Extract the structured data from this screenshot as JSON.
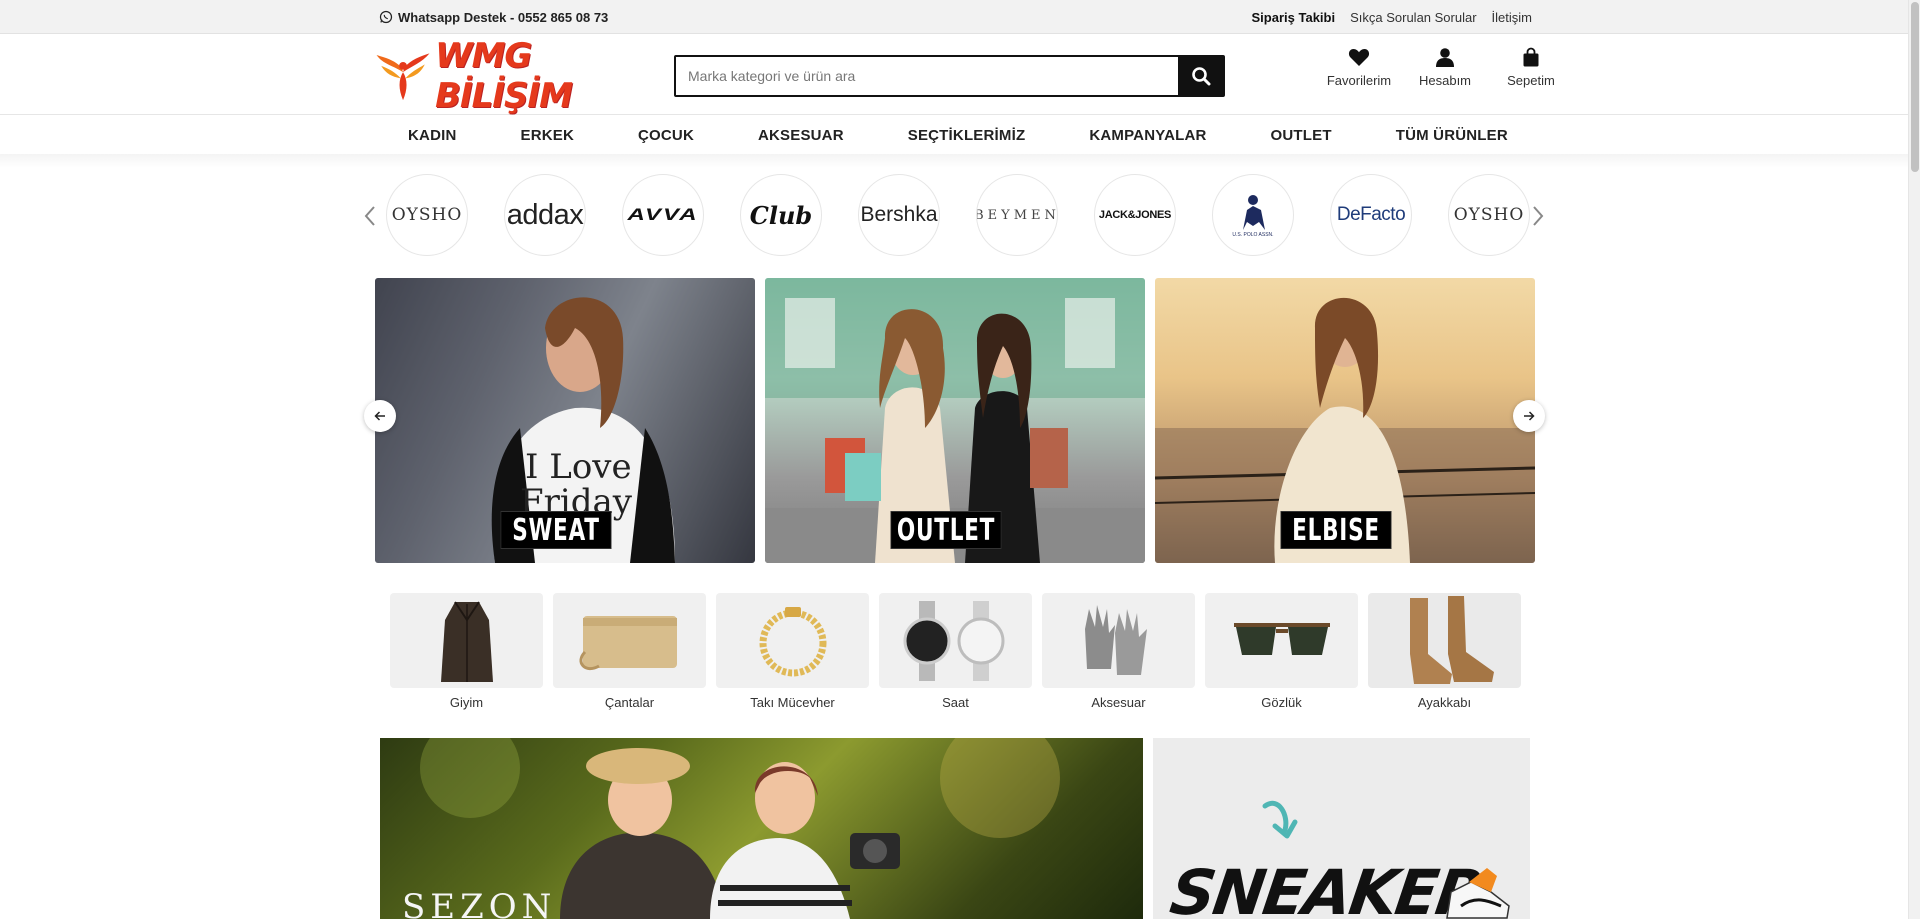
{
  "topbar": {
    "whatsapp": "Whatsapp Destek - 0552 865 08 73",
    "links": [
      "Sipariş Takibi",
      "Sıkça Sorulan Sorular",
      "İletişim"
    ]
  },
  "header": {
    "logo_text": "WMG BİLİŞİM",
    "search_placeholder": "Marka kategori ve ürün ara",
    "icons": [
      {
        "label": "Favorilerim",
        "icon": "heart-icon"
      },
      {
        "label": "Hesabım",
        "icon": "user-icon"
      },
      {
        "label": "Sepetim",
        "icon": "shopping-bag-icon"
      }
    ]
  },
  "nav": [
    "KADIN",
    "ERKEK",
    "ÇOCUK",
    "AKSESUAR",
    "SEÇTİKLERİMİZ",
    "KAMPANYALAR",
    "OUTLET",
    "TÜM ÜRÜNLER"
  ],
  "brands": [
    "OYSHO",
    "addax",
    "AVVA",
    "Club",
    "Bershka",
    "BEYMEN",
    "JACK&JONES",
    "U.S. POLO ASSN.",
    "DeFacto",
    "OYSHO"
  ],
  "slides": [
    "SWEAT",
    "OUTLET",
    "ELBISE"
  ],
  "categories": [
    "Giyim",
    "Çantalar",
    "Takı Mücevher",
    "Saat",
    "Aksesuar",
    "Gözlük",
    "Ayakkabı"
  ],
  "banners": {
    "left_text": "SEZON",
    "right_text": "SNEAKER"
  }
}
